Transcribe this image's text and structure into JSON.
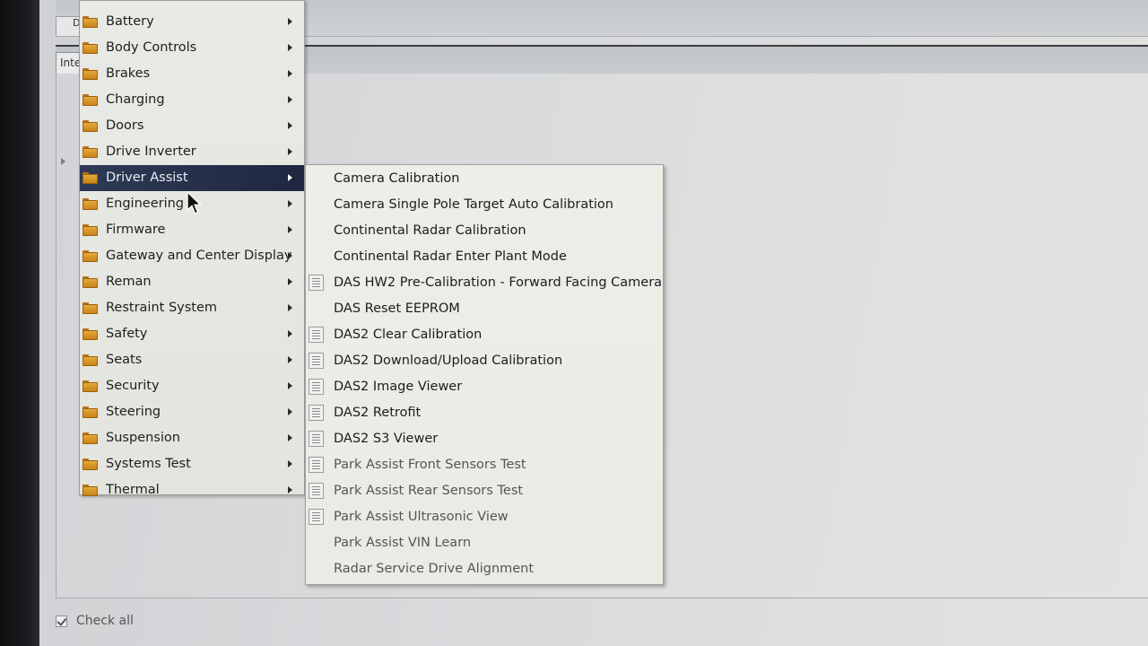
{
  "window": {
    "top_tab_label": "D",
    "inner_tab_label": "Inte",
    "check_all_label": "Check all",
    "check_all_checked": true
  },
  "category_menu": {
    "items": [
      {
        "label": "Battery",
        "icon": "folder-icon"
      },
      {
        "label": "Body Controls",
        "icon": "folder-icon"
      },
      {
        "label": "Brakes",
        "icon": "folder-icon"
      },
      {
        "label": "Charging",
        "icon": "folder-icon"
      },
      {
        "label": "Doors",
        "icon": "folder-icon"
      },
      {
        "label": "Drive Inverter",
        "icon": "folder-icon"
      },
      {
        "label": "Driver Assist",
        "icon": "folder-icon",
        "selected": true
      },
      {
        "label": "Engineering",
        "icon": "folder-icon"
      },
      {
        "label": "Firmware",
        "icon": "folder-icon"
      },
      {
        "label": "Gateway and Center Display",
        "icon": "folder-icon"
      },
      {
        "label": "Reman",
        "icon": "folder-icon"
      },
      {
        "label": "Restraint System",
        "icon": "folder-icon"
      },
      {
        "label": "Safety",
        "icon": "folder-icon"
      },
      {
        "label": "Seats",
        "icon": "folder-icon"
      },
      {
        "label": "Security",
        "icon": "folder-icon"
      },
      {
        "label": "Steering",
        "icon": "folder-icon"
      },
      {
        "label": "Suspension",
        "icon": "folder-icon"
      },
      {
        "label": "Systems Test",
        "icon": "folder-icon"
      },
      {
        "label": "Thermal",
        "icon": "folder-icon"
      }
    ]
  },
  "driver_assist_submenu": {
    "items": [
      {
        "label": "Camera Calibration",
        "icon": null
      },
      {
        "label": "Camera Single Pole Target Auto Calibration",
        "icon": null
      },
      {
        "label": "Continental Radar Calibration",
        "icon": null
      },
      {
        "label": "Continental Radar Enter Plant Mode",
        "icon": null
      },
      {
        "label": "DAS HW2 Pre-Calibration - Forward Facing Camera",
        "icon": "document-icon"
      },
      {
        "label": "DAS Reset EEPROM",
        "icon": null
      },
      {
        "label": "DAS2 Clear Calibration",
        "icon": "document-icon"
      },
      {
        "label": "DAS2 Download/Upload Calibration",
        "icon": "document-icon"
      },
      {
        "label": "DAS2 Image Viewer",
        "icon": "document-icon"
      },
      {
        "label": "DAS2 Retrofit",
        "icon": "document-icon"
      },
      {
        "label": "DAS2 S3 Viewer",
        "icon": "document-icon"
      },
      {
        "label": "Park Assist Front Sensors Test",
        "icon": "document-icon"
      },
      {
        "label": "Park Assist Rear Sensors Test",
        "icon": "document-icon"
      },
      {
        "label": "Park Assist Ultrasonic View",
        "icon": "document-icon"
      },
      {
        "label": "Park Assist VIN Learn",
        "icon": null
      },
      {
        "label": "Radar Service Drive Alignment",
        "icon": null
      }
    ]
  },
  "colors": {
    "selection": "#1f2740",
    "folder": "#d99a2b",
    "menu_bg": "#e9e9e5"
  }
}
